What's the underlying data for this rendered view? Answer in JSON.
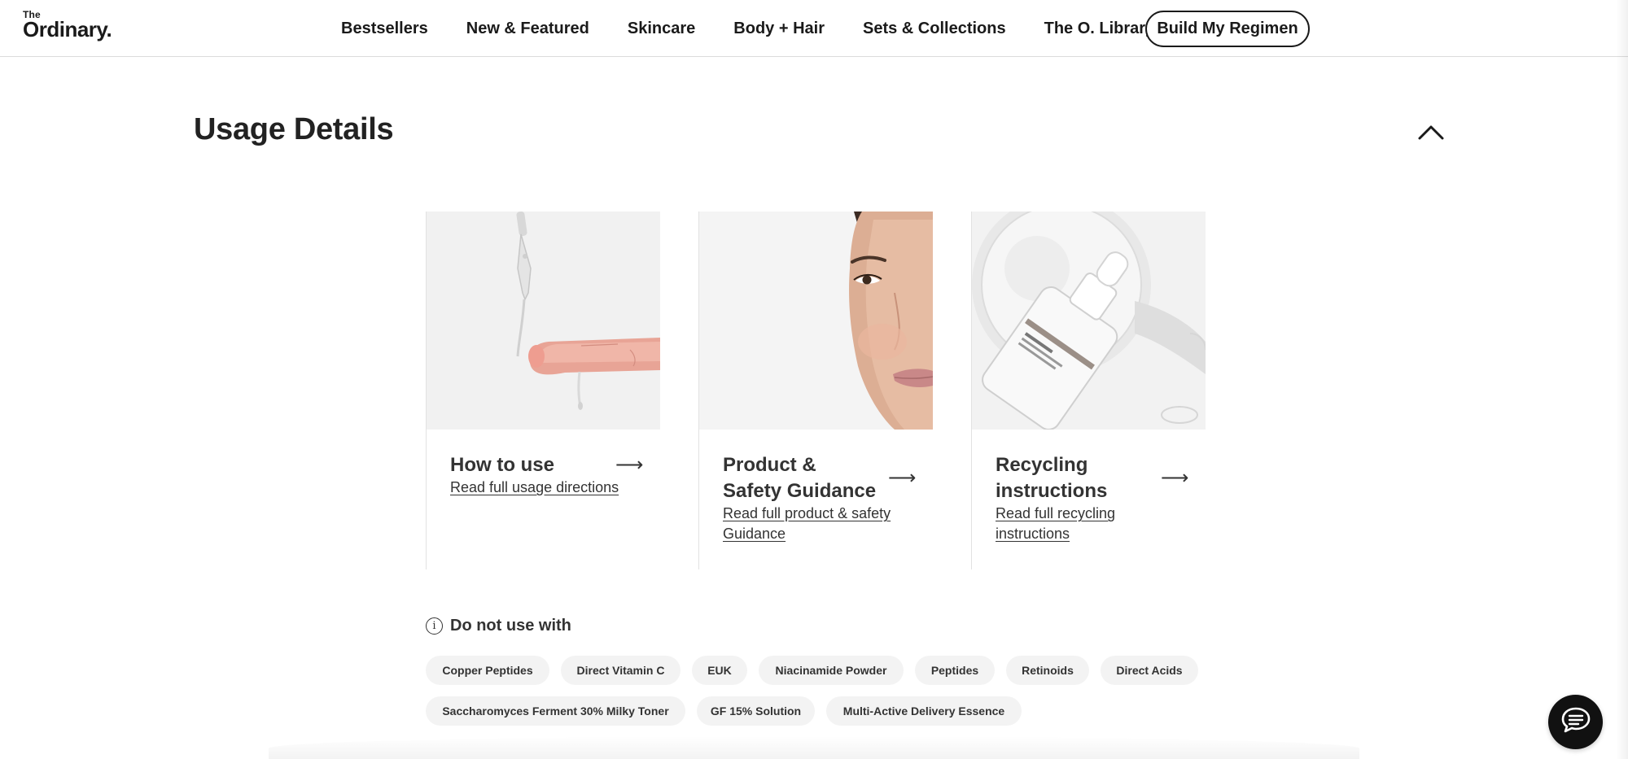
{
  "header": {
    "logo_top": "The",
    "logo_main": "Ordinary.",
    "nav": [
      "Bestsellers",
      "New & Featured",
      "Skincare",
      "Body + Hair",
      "Sets & Collections",
      "The O. Library"
    ],
    "cta_label": "Build My Regimen"
  },
  "usage": {
    "title": "Usage Details",
    "cards": [
      {
        "title": "How to use",
        "link": "Read full usage directions",
        "image": "dropper-serum-on-finger"
      },
      {
        "title": "Product & Safety Guidance",
        "link": "Read full product & safety Guidance",
        "image": "woman-face-portrait"
      },
      {
        "title": "Recycling instructions",
        "link": "Read full recycling instructions",
        "image": "dropper-bottle-product"
      }
    ]
  },
  "warning": {
    "label": "Do not use with",
    "chips": [
      "Copper Peptides",
      "Direct Vitamin C",
      "EUK",
      "Niacinamide Powder",
      "Peptides",
      "Retinoids",
      "Direct Acids",
      "Saccharomyces Ferment 30% Milky Toner",
      "GF 15% Solution",
      "Multi-Active Delivery Essence"
    ]
  },
  "icons": {
    "collapse": "chevron-up-icon",
    "arrow": "arrow-right-icon",
    "info": "info-icon",
    "chat": "chat-bubble-icon"
  }
}
